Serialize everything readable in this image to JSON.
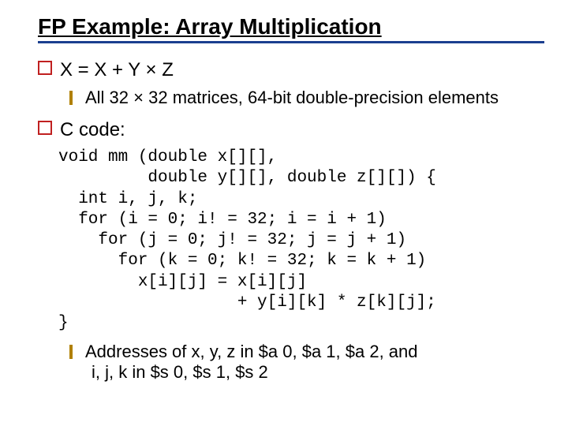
{
  "title": "FP Example: Array Multiplication",
  "point1": "X = X + Y × Z",
  "sub1": "All 32 × 32 matrices, 64-bit double-precision elements",
  "point2": "C code:",
  "code": "void mm (double x[][],\n         double y[][], double z[][]) {\n  int i, j, k;\n  for (i = 0; i! = 32; i = i + 1)\n    for (j = 0; j! = 32; j = j + 1)\n      for (k = 0; k! = 32; k = k + 1)\n        x[i][j] = x[i][j]\n                  + y[i][k] * z[k][j];\n}",
  "sub2_line1": "Addresses of x, y, z in $a 0, $a 1, $a 2, and",
  "sub2_line2": "i, j, k in $s 0, $s 1, $s 2"
}
